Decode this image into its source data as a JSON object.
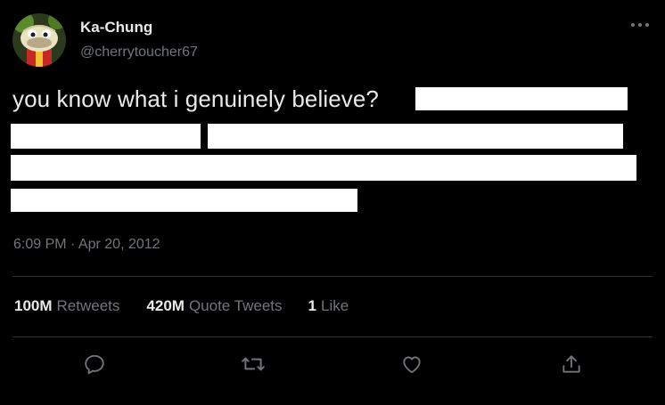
{
  "author": {
    "display_name": "Ka-Chung",
    "handle": "@cherrytoucher67",
    "avatar_icon": "cartoon-character-avatar"
  },
  "tweet": {
    "text": "you know what i genuinely believe?",
    "redacted_text": true,
    "timestamp": "6:09 PM · Apr 20, 2012"
  },
  "stats": {
    "retweets_value": "100M",
    "retweets_label": "Retweets",
    "quotes_value": "420M",
    "quotes_label": "Quote Tweets",
    "likes_value": "1",
    "likes_label": "Like"
  },
  "actions": {
    "icons": [
      "reply-icon",
      "retweet-icon",
      "like-icon",
      "share-icon"
    ]
  },
  "colors": {
    "background": "#000000",
    "primary_text": "#e7e9ea",
    "secondary_text": "#71767b",
    "divider": "#2f3336",
    "redaction": "#ffffff"
  }
}
